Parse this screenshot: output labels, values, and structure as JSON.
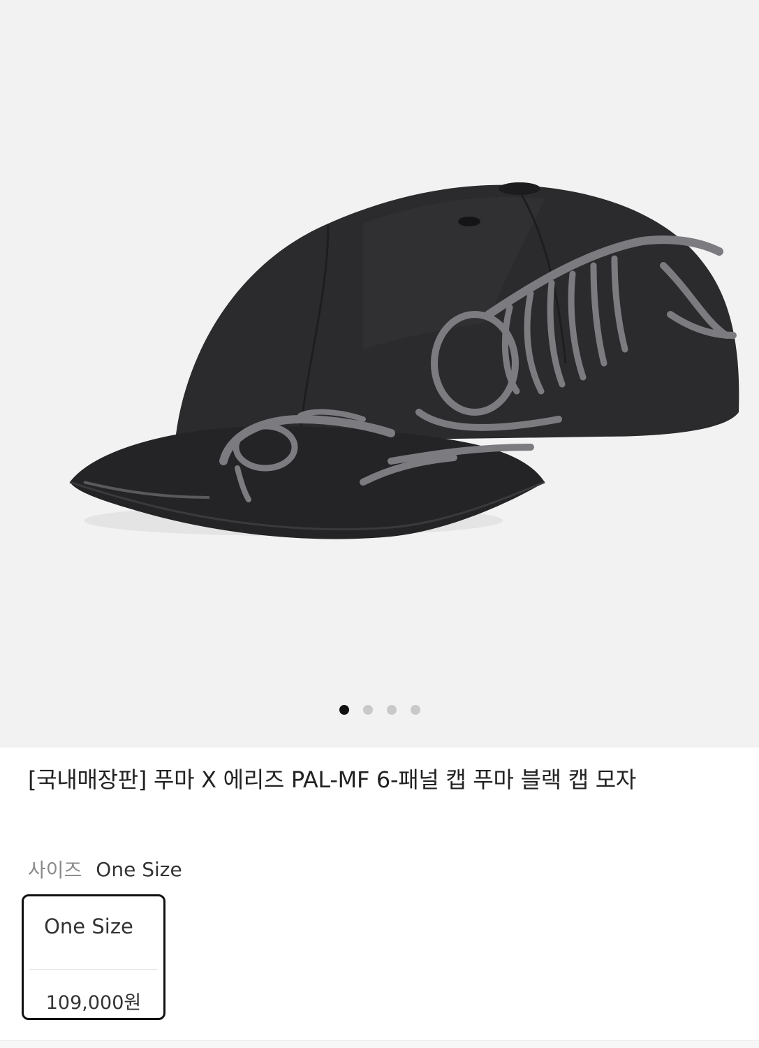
{
  "product": {
    "title": "[국내매장판] 푸마 X 에리즈 PAL-MF 6-패널 캡 푸마 블랙 캡 모자",
    "image_icon": "cap-photo",
    "gallery": {
      "total_images": 4,
      "active_index": 0
    }
  },
  "size": {
    "label": "사이즈",
    "selected": "One Size"
  },
  "options": [
    {
      "size": "One Size",
      "price": "109,000원",
      "selected": true
    }
  ],
  "colors": {
    "gallery_bg": "#f2f2f2",
    "cap_body": "#2a2a2c",
    "embroidery": "#7c7c80",
    "active_dot": "#111111",
    "inactive_dot": "#c9c9c9"
  }
}
